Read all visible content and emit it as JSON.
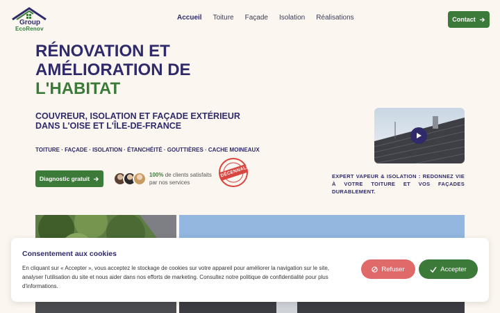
{
  "logo": {
    "line1": "Group",
    "line2": "EcoRenov"
  },
  "nav": {
    "items": [
      "Accueil",
      "Toiture",
      "Façade",
      "Isolation",
      "Réalisations"
    ]
  },
  "header": {
    "contact_label": "Contact"
  },
  "hero": {
    "title_line1": "RÉNOVATION ET",
    "title_line2": "AMÉLIORATION DE",
    "title_line3": "L'HABITAT",
    "subtitle": "COUVREUR, ISOLATION ET FAÇADE EXTÉRIEUR DANS L'OISE ET L'ÎLE-DE-FRANCE",
    "services": "TOITURE · FAÇADE · ISOLATION · ÉTANCHÉITÉ · GOUTTIÈRES · CACHE MOINEAUX",
    "cta_label": "Diagnostic gratuit",
    "stat_percent": "100%",
    "stat_text_1": " de clients satisfaits",
    "stat_text_2": "par nos services",
    "seal_text": "DÉCENNALE",
    "tagline": "EXPERT VAPEUR & ISOLATION : REDONNEZ VIE À VOTRE TOITURE ET VOS FAÇADES DURABLEMENT."
  },
  "cookie": {
    "title": "Consentement aux cookies",
    "text": "En cliquant sur « Accepter », vous acceptez le stockage de cookies sur votre appareil pour améliorer la navigation sur le site, analyser l'utilisation du site et nous aider dans nos efforts de marketing. Consultez notre politique de confidentialité pour plus d'informations.",
    "refuse_label": "Refuser",
    "accept_label": "Accepter"
  },
  "colors": {
    "primary": "#2f2a6a",
    "green": "#3c7a3a",
    "refuse": "#e06a6a",
    "background": "#fbf7f0"
  }
}
